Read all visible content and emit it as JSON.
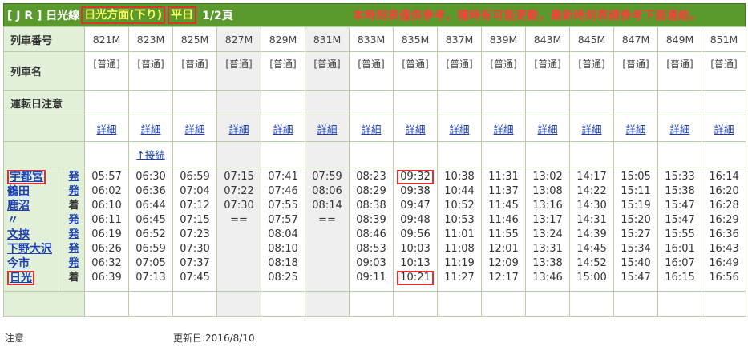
{
  "title": {
    "line_label": "[ J R ] 日光線",
    "direction": "日光方面(下り)",
    "day": "平日",
    "page": "1/2頁",
    "notice": "本時刻表僅供參考，隨時有可能更動，最新時刻表請參考下面連結。"
  },
  "headers": {
    "train_number": "列車番号",
    "train_name": "列車名",
    "operation_note": "運転日注意"
  },
  "trains": [
    {
      "number": "821M",
      "type": "[普通]",
      "detail": "詳細",
      "times": [
        "05:57",
        "06:02",
        "06:10",
        "06:11",
        "06:19",
        "06:26",
        "06:32",
        "06:39"
      ],
      "gray": false
    },
    {
      "number": "823M",
      "type": "[普通]",
      "detail": "詳細",
      "link": "↑接続",
      "times": [
        "06:30",
        "06:36",
        "06:44",
        "06:45",
        "06:52",
        "06:59",
        "07:05",
        "07:13"
      ],
      "gray": false
    },
    {
      "number": "825M",
      "type": "[普通]",
      "detail": "詳細",
      "times": [
        "06:59",
        "07:04",
        "07:12",
        "07:15",
        "07:23",
        "07:30",
        "07:37",
        "07:45"
      ],
      "gray": false
    },
    {
      "number": "827M",
      "type": "[普通]",
      "detail": "詳細",
      "times": [
        "07:15",
        "07:22",
        "07:30",
        "==",
        "",
        "",
        "",
        ""
      ],
      "gray": true
    },
    {
      "number": "829M",
      "type": "[普通]",
      "detail": "詳細",
      "times": [
        "07:41",
        "07:46",
        "07:55",
        "07:57",
        "08:04",
        "08:10",
        "08:18",
        "08:25"
      ],
      "gray": false
    },
    {
      "number": "831M",
      "type": "[普通]",
      "detail": "詳細",
      "times": [
        "07:59",
        "08:06",
        "08:14",
        "==",
        "",
        "",
        "",
        ""
      ],
      "gray": true
    },
    {
      "number": "833M",
      "type": "[普通]",
      "detail": "詳細",
      "times": [
        "08:23",
        "08:29",
        "08:38",
        "08:39",
        "08:46",
        "08:53",
        "09:03",
        "09:11"
      ],
      "gray": false
    },
    {
      "number": "835M",
      "type": "[普通]",
      "detail": "詳細",
      "times": [
        "09:32",
        "09:38",
        "09:47",
        "09:48",
        "09:56",
        "10:03",
        "10:13",
        "10:21"
      ],
      "gray": false
    },
    {
      "number": "837M",
      "type": "[普通]",
      "detail": "詳細",
      "times": [
        "10:38",
        "10:44",
        "10:52",
        "10:53",
        "11:01",
        "11:08",
        "11:19",
        "11:27"
      ],
      "gray": false
    },
    {
      "number": "839M",
      "type": "[普通]",
      "detail": "詳細",
      "times": [
        "11:31",
        "11:37",
        "11:45",
        "11:46",
        "11:55",
        "12:01",
        "12:09",
        "12:17"
      ],
      "gray": false
    },
    {
      "number": "843M",
      "type": "[普通]",
      "detail": "詳細",
      "times": [
        "13:02",
        "13:08",
        "13:16",
        "13:17",
        "13:24",
        "13:31",
        "13:38",
        "13:46"
      ],
      "gray": false
    },
    {
      "number": "845M",
      "type": "[普通]",
      "detail": "詳細",
      "times": [
        "14:17",
        "14:22",
        "14:30",
        "14:31",
        "14:39",
        "14:45",
        "14:52",
        "15:00"
      ],
      "gray": false
    },
    {
      "number": "847M",
      "type": "[普通]",
      "detail": "詳細",
      "times": [
        "15:05",
        "15:11",
        "15:19",
        "15:20",
        "15:27",
        "15:34",
        "15:40",
        "15:47"
      ],
      "gray": false
    },
    {
      "number": "849M",
      "type": "[普通]",
      "detail": "詳細",
      "times": [
        "15:33",
        "15:38",
        "15:47",
        "15:47",
        "15:55",
        "16:01",
        "16:07",
        "16:15"
      ],
      "gray": false
    },
    {
      "number": "851M",
      "type": "[普通]",
      "detail": "詳細",
      "times": [
        "16:14",
        "16:20",
        "16:28",
        "16:29",
        "16:36",
        "16:43",
        "16:49",
        "16:56"
      ],
      "gray": false
    }
  ],
  "stations": [
    {
      "name": "宇都宮",
      "mark": "発"
    },
    {
      "name": "鶴田",
      "mark": "発"
    },
    {
      "name": "鹿沼",
      "mark": "着"
    },
    {
      "name": "〃",
      "mark": "発"
    },
    {
      "name": "文挟",
      "mark": "発"
    },
    {
      "name": "下野大沢",
      "mark": "発"
    },
    {
      "name": "今市",
      "mark": "発"
    },
    {
      "name": "日光",
      "mark": "着"
    }
  ],
  "footer": {
    "note_label": "注意",
    "updated": "更新日:2016/8/10"
  },
  "colors": {
    "title_bg": "#5a9a2c",
    "header_bg": "#e3f0d9",
    "highlight_box": "#e03030",
    "link": "#1a3fb5",
    "notice": "#ff3b3b"
  }
}
